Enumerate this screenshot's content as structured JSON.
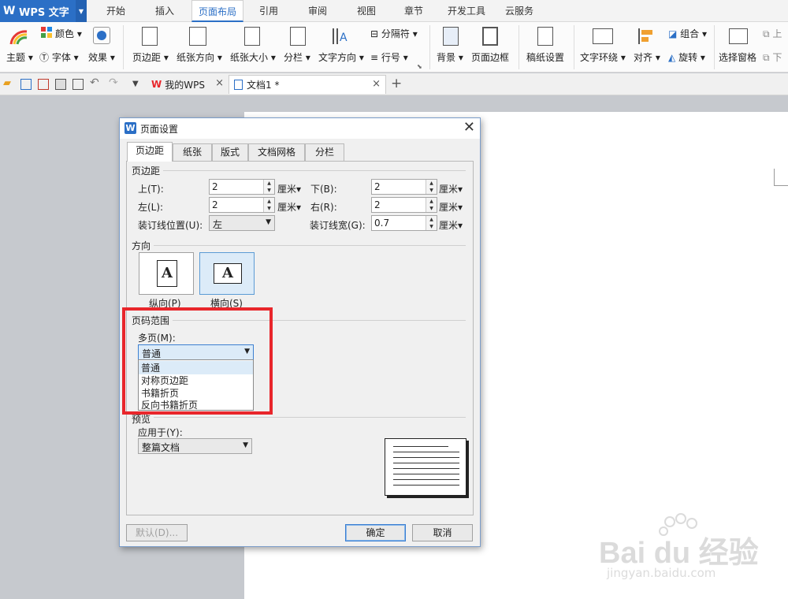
{
  "app": {
    "name": "WPS 文字"
  },
  "menu": {
    "tabs": [
      "开始",
      "插入",
      "页面布局",
      "引用",
      "审阅",
      "视图",
      "章节",
      "开发工具",
      "云服务"
    ],
    "active": "页面布局"
  },
  "ribbon": {
    "color": "颜色",
    "theme": "主题",
    "font": "字体",
    "effect": "效果",
    "margins": "页边距",
    "orientation": "纸张方向",
    "size": "纸张大小",
    "columns": "分栏",
    "text_direction": "文字方向",
    "separator": "分隔符",
    "line_number": "行号",
    "background": "背景",
    "page_border": "页面边框",
    "grid_paper": "稿纸设置",
    "wrap": "文字环绕",
    "align": "对齐",
    "group": "组合",
    "rotate": "旋转",
    "selection_pane": "选择窗格",
    "up": "上",
    "down": "下"
  },
  "doc_tabs": {
    "my_wps": "我的WPS",
    "doc1": "文档1 *"
  },
  "dialog": {
    "title": "页面设置",
    "tabs": [
      "页边距",
      "纸张",
      "版式",
      "文档网格",
      "分栏"
    ],
    "margins_section": "页边距",
    "top_label": "上(T):",
    "top_value": "2",
    "bottom_label": "下(B):",
    "bottom_value": "2",
    "left_label": "左(L):",
    "left_value": "2",
    "right_label": "右(R):",
    "right_value": "2",
    "unit": "厘米▾",
    "gutter_pos_label": "装订线位置(U):",
    "gutter_pos_value": "左",
    "gutter_width_label": "装订线宽(G):",
    "gutter_width_value": "0.7",
    "orientation_section": "方向",
    "portrait": "纵向(P)",
    "landscape": "横向(S)",
    "page_range_section": "页码范围",
    "multi_page_label": "多页(M):",
    "multi_page_value": "普通",
    "multi_page_options": [
      "普通",
      "对称页边距",
      "书籍折页",
      "反向书籍折页"
    ],
    "preview_section": "预览",
    "apply_label": "应用于(Y):",
    "apply_value": "整篇文档",
    "default_button": "默认(D)...",
    "ok_button": "确定",
    "cancel_button": "取消"
  },
  "watermark": {
    "brand": "Bai du 经验",
    "url": "jingyan.baidu.com"
  },
  "colors": {
    "accent": "#2b6fc6",
    "highlight_box": "#e8262b"
  }
}
